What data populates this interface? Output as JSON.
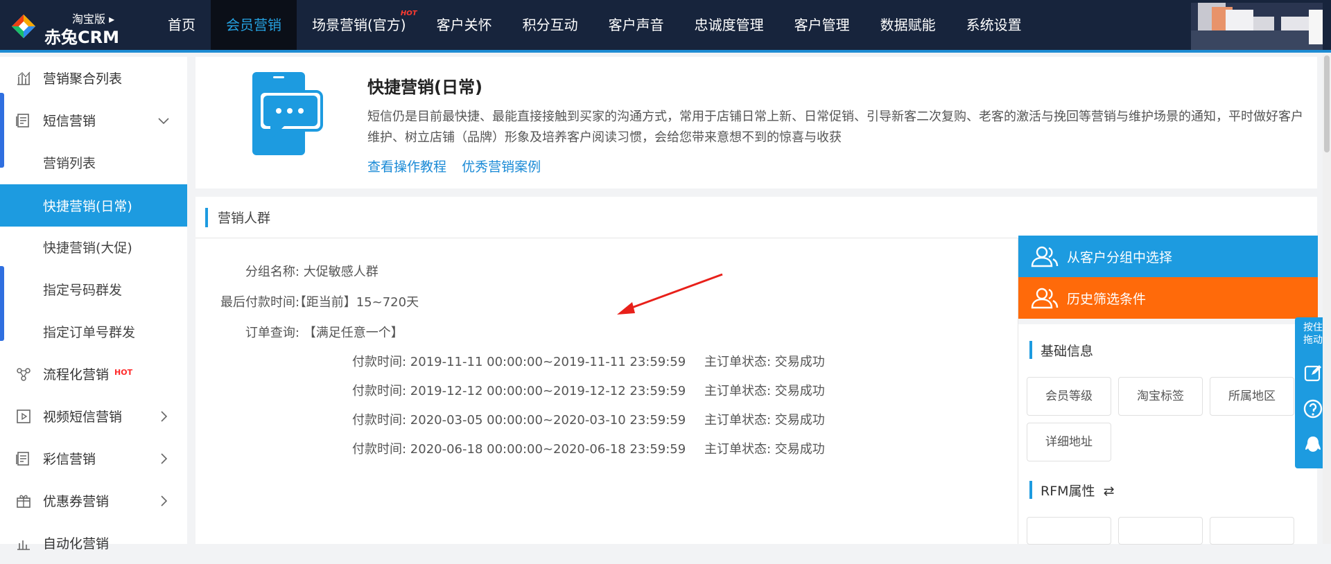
{
  "header": {
    "logo_sub": "淘宝版",
    "logo_name": "赤兔CRM",
    "nav": [
      {
        "label": "首页"
      },
      {
        "label": "会员营销",
        "active": true
      },
      {
        "label": "场景营销(官方)",
        "badge": "HOT"
      },
      {
        "label": "客户关怀"
      },
      {
        "label": "积分互动"
      },
      {
        "label": "客户声音"
      },
      {
        "label": "忠诚度管理"
      },
      {
        "label": "客户管理"
      },
      {
        "label": "数据赋能"
      },
      {
        "label": "系统设置"
      }
    ]
  },
  "sidebar": {
    "items": [
      {
        "label": "营销聚合列表",
        "icon": "chart-icon"
      },
      {
        "label": "短信营销",
        "icon": "sms-icon",
        "expanded": true
      },
      {
        "label": "营销列表"
      },
      {
        "label": "快捷营销(日常)",
        "active": true
      },
      {
        "label": "快捷营销(大促)"
      },
      {
        "label": "指定号码群发"
      },
      {
        "label": "指定订单号群发"
      },
      {
        "label": "流程化营销",
        "icon": "flow-icon",
        "badge": "HOT"
      },
      {
        "label": "视频短信营销",
        "icon": "video-icon"
      },
      {
        "label": "彩信营销",
        "icon": "mms-icon"
      },
      {
        "label": "优惠券营销",
        "icon": "coupon-icon"
      },
      {
        "label": "自动化营销",
        "icon": "auto-icon"
      }
    ]
  },
  "intro": {
    "title": "快捷营销(日常)",
    "desc": "短信仍是目前最快捷、最能直接接触到买家的沟通方式，常用于店铺日常上新、日常促销、引导新客二次复购、老客的激活与挽回等营销与维护场景的通知，平时做好客户维护、树立店铺（品牌）形象及培养客户阅读习惯，会给您带来意想不到的惊喜与收获",
    "link1": "查看操作教程",
    "link2": "优秀营销案例"
  },
  "crowd": {
    "section_title": "营销人群",
    "group_label": "分组名称:",
    "group_value": "大促敏感人群",
    "last_pay_label": "最后付款时间:",
    "last_pay_value": "【距当前】15~720天",
    "order_label": "订单查询:",
    "order_value": "【满足任意一个】",
    "conditions": [
      {
        "time": "付款时间:  2019-11-11 00:00:00~2019-11-11 23:59:59",
        "status": "主订单状态:  交易成功"
      },
      {
        "time": "付款时间:  2019-12-12 00:00:00~2019-12-12 23:59:59",
        "status": "主订单状态:  交易成功"
      },
      {
        "time": "付款时间:  2020-03-05 00:00:00~2020-03-10 23:59:59",
        "status": "主订单状态:  交易成功"
      },
      {
        "time": "付款时间:  2020-06-18 00:00:00~2020-06-18 23:59:59",
        "status": "主订单状态:  交易成功"
      }
    ]
  },
  "right_panel": {
    "btn_group": "从客户分组中选择",
    "btn_history": "历史筛选条件",
    "basic_title": "基础信息",
    "basic_tags": [
      "会员等级",
      "淘宝标签",
      "所属地区",
      "详细地址"
    ],
    "rfm_title": "RFM属性"
  },
  "float_bar": {
    "drag_label": "按住拖动"
  },
  "colors": {
    "accent_blue": "#1d9be0",
    "orange": "#ff6a0a",
    "topbar": "#17243c"
  }
}
